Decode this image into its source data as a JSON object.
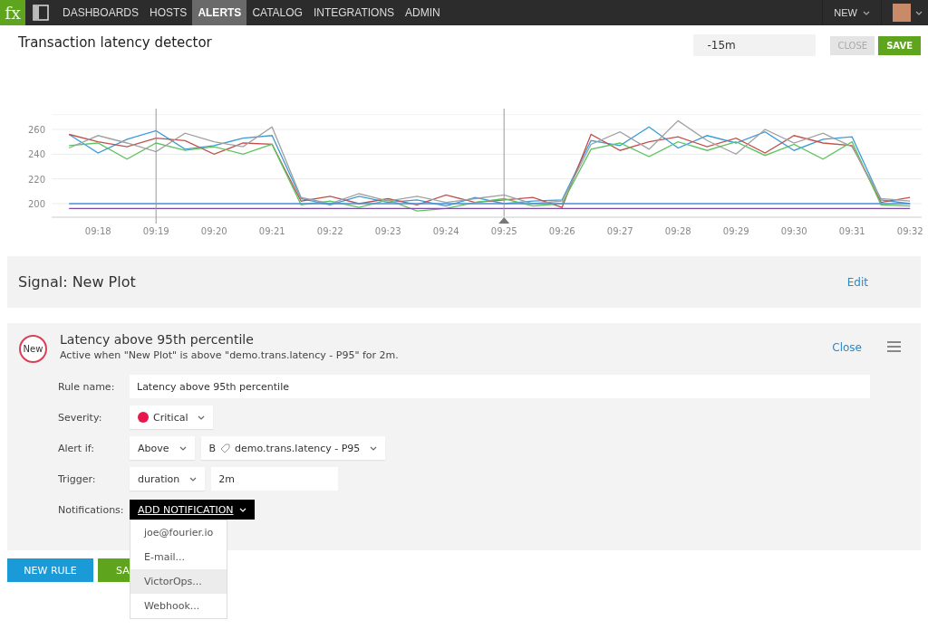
{
  "nav": {
    "logo": "fx",
    "items": [
      {
        "label": "DASHBOARDS",
        "selected": false
      },
      {
        "label": "HOSTS",
        "selected": false
      },
      {
        "label": "ALERTS",
        "selected": true
      },
      {
        "label": "CATALOG",
        "selected": false
      },
      {
        "label": "INTEGRATIONS",
        "selected": false
      },
      {
        "label": "ADMIN",
        "selected": false
      }
    ],
    "new_menu": "NEW"
  },
  "header": {
    "title": "Transaction latency detector",
    "time_range": "-15m",
    "close": "CLOSE",
    "save": "SAVE"
  },
  "chart_data": {
    "type": "line",
    "categories": [
      null,
      "09:18",
      null,
      "09:19",
      null,
      "09:20",
      null,
      "09:21",
      null,
      "09:22",
      null,
      "09:23",
      null,
      "09:24",
      null,
      "09:25",
      null,
      "09:26",
      null,
      "09:27",
      null,
      "09:28",
      null,
      "09:29",
      null,
      "09:30",
      null,
      "09:31",
      null,
      "09:32"
    ],
    "ylim": [
      189,
      272
    ],
    "yticks": [
      200,
      220,
      240,
      260
    ],
    "grid": true,
    "series": [
      {
        "color": "#3a9bd9",
        "values": [
          256,
          241,
          252,
          259,
          244,
          247,
          253,
          255,
          204,
          199,
          206,
          201,
          203,
          198,
          205,
          200,
          202,
          203,
          251,
          247,
          262,
          245,
          255,
          249,
          258,
          243,
          252,
          254,
          203,
          200
        ]
      },
      {
        "color": "#c0504d",
        "values": [
          256,
          250,
          246,
          253,
          251,
          240,
          249,
          248,
          202,
          206,
          200,
          204,
          199,
          207,
          201,
          203,
          205,
          197,
          256,
          243,
          250,
          254,
          246,
          253,
          241,
          255,
          249,
          247,
          201,
          205
        ]
      },
      {
        "color": "#5cc45c",
        "values": [
          247,
          249,
          236,
          249,
          243,
          246,
          240,
          248,
          199,
          202,
          197,
          203,
          194,
          196,
          201,
          204,
          198,
          200,
          244,
          249,
          238,
          250,
          243,
          250,
          239,
          248,
          236,
          250,
          199,
          198
        ]
      },
      {
        "color": "#a0a0a0",
        "values": [
          245,
          255,
          249,
          242,
          257,
          250,
          246,
          262,
          205,
          200,
          208,
          202,
          206,
          201,
          204,
          207,
          200,
          202,
          248,
          258,
          244,
          267,
          251,
          240,
          260,
          249,
          257,
          246,
          204,
          202
        ]
      },
      {
        "color": "#4a90d9",
        "values": [
          200,
          200,
          200,
          200,
          200,
          200,
          200,
          200,
          200,
          200,
          200,
          200,
          200,
          200,
          200,
          200,
          200,
          200,
          200,
          200,
          200,
          200,
          200,
          200,
          200,
          200,
          200,
          200,
          200,
          200
        ]
      },
      {
        "color": "#7a4aa0",
        "values": [
          196,
          196,
          196,
          196,
          196,
          196,
          196,
          196,
          196,
          196,
          196,
          196,
          196,
          196,
          196,
          196,
          196,
          196,
          196,
          196,
          196,
          196,
          196,
          196,
          196,
          196,
          196,
          196,
          196,
          196
        ]
      }
    ]
  },
  "signal": {
    "title": "Signal: New Plot",
    "edit": "Edit"
  },
  "rule": {
    "badge": "New",
    "title": "Latency above 95th percentile",
    "summary": "Active when \"New Plot\" is above \"demo.trans.latency - P95\" for 2m.",
    "close": "Close",
    "rule_name_label": "Rule name:",
    "rule_name": "Latency above 95th percentile",
    "severity_label": "Severity:",
    "severity": {
      "label": "Critical",
      "color": "#e8174b"
    },
    "alert_if_label": "Alert if:",
    "comparison": "Above",
    "signal_letter": "B",
    "signal_name": "demo.trans.latency - P95",
    "trigger_label": "Trigger:",
    "trigger": "duration",
    "duration": "2m",
    "notifications_label": "Notifications:",
    "add_notification": "ADD NOTIFICATION",
    "notification_menu": [
      {
        "label": "joe@fourier.io",
        "selected": false
      },
      {
        "label": "E-mail...",
        "selected": false
      },
      {
        "label": "VictorOps...",
        "selected": true
      },
      {
        "label": "Webhook...",
        "selected": false
      }
    ]
  },
  "footer": {
    "new_rule": "NEW RULE",
    "save": "SA"
  }
}
